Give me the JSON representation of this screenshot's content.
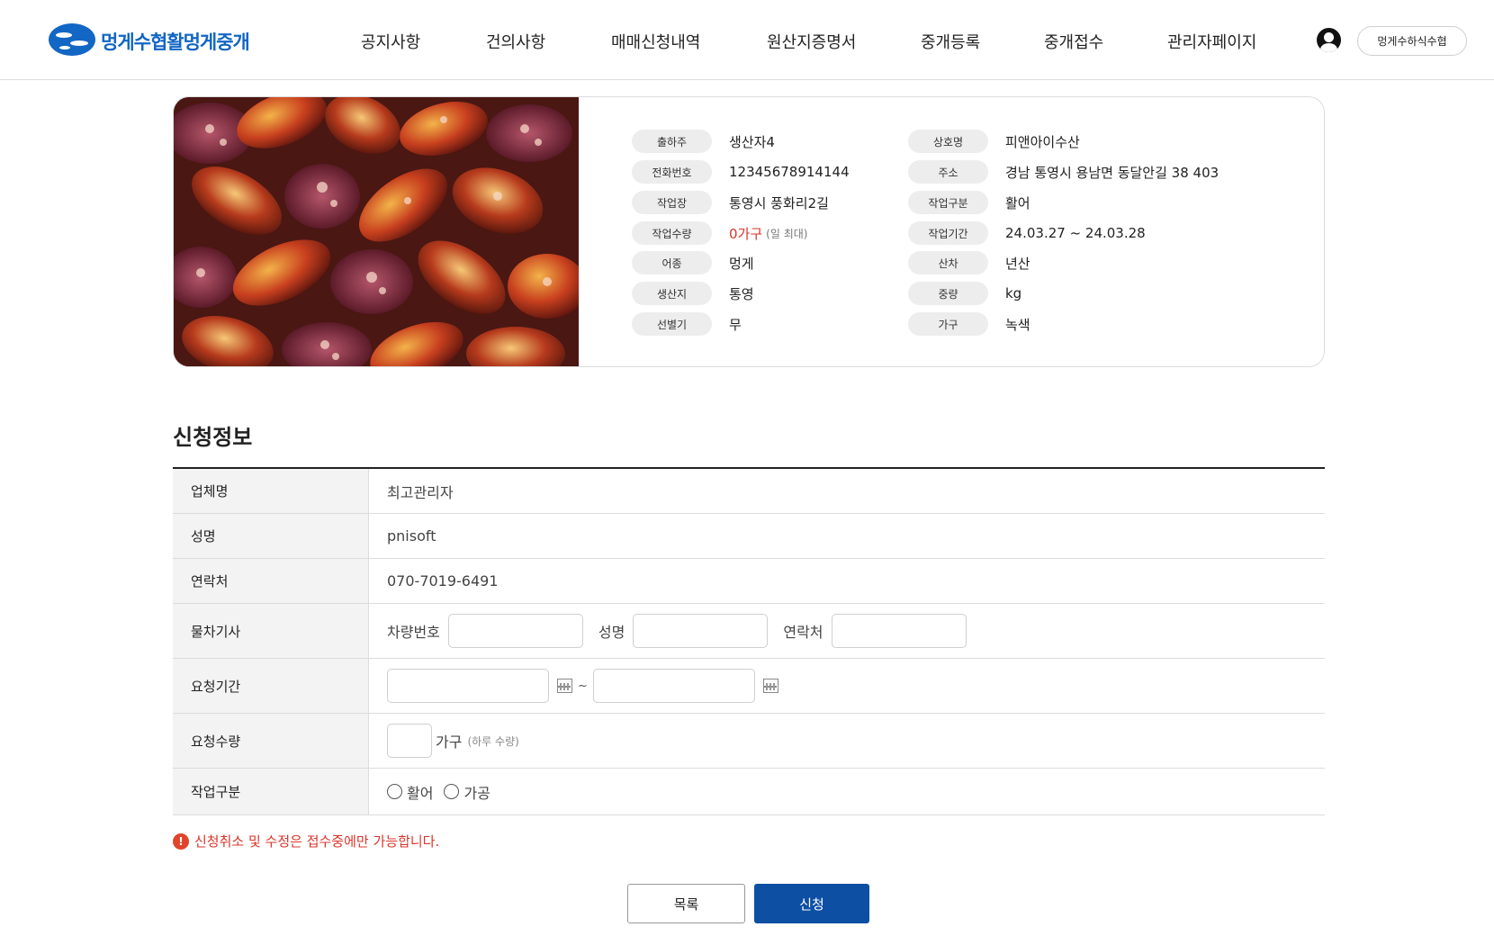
{
  "header": {
    "logo_text": "멍게수협활멍게중개",
    "nav": [
      "공지사항",
      "건의사항",
      "매매신청내역",
      "원산지증명서",
      "중개등록",
      "중개접수",
      "관리자페이지"
    ],
    "user_badge": "멍게수하식수협"
  },
  "product": {
    "left": [
      {
        "label": "출하주",
        "value": "생산자4"
      },
      {
        "label": "전화번호",
        "value": "12345678914144"
      },
      {
        "label": "작업장",
        "value": "통영시 풍화리2길"
      },
      {
        "label": "작업수량",
        "value": "0가구",
        "note": "(일 최대)"
      },
      {
        "label": "어종",
        "value": "멍게"
      },
      {
        "label": "생산지",
        "value": "통영"
      },
      {
        "label": "선별기",
        "value": "무"
      }
    ],
    "right": [
      {
        "label": "상호명",
        "value": "피앤아이수산"
      },
      {
        "label": "주소",
        "value": "경남 통영시 용남면 동달안길 38 403"
      },
      {
        "label": "작업구분",
        "value": "활어"
      },
      {
        "label": "작업기간",
        "value": "24.03.27 ~ 24.03.28"
      },
      {
        "label": "산차",
        "value": "년산"
      },
      {
        "label": "중량",
        "value": "kg"
      },
      {
        "label": "가구",
        "value": "녹색"
      }
    ]
  },
  "form": {
    "title": "신청정보",
    "company_label": "업체명",
    "company_value": "최고관리자",
    "name_label": "성명",
    "name_value": "pnisoft",
    "contact_label": "연락처",
    "contact_value": "070-7019-6491",
    "driver_label": "물차기사",
    "driver_vehicle_label": "차량번호",
    "driver_name_label": "성명",
    "driver_contact_label": "연락처",
    "period_label": "요청기간",
    "period_sep": "~",
    "qty_label": "요청수량",
    "qty_unit": "가구",
    "qty_note": "(하루 수량)",
    "work_label": "작업구분",
    "work_options": [
      "활어",
      "가공"
    ]
  },
  "notice": "신청취소 및 수정은 접수중에만 가능합니다.",
  "buttons": {
    "list": "목록",
    "submit": "신청"
  },
  "colors": {
    "brand": "#1266c4",
    "primary_button": "#0c4fa3",
    "warning": "#d9362b"
  }
}
